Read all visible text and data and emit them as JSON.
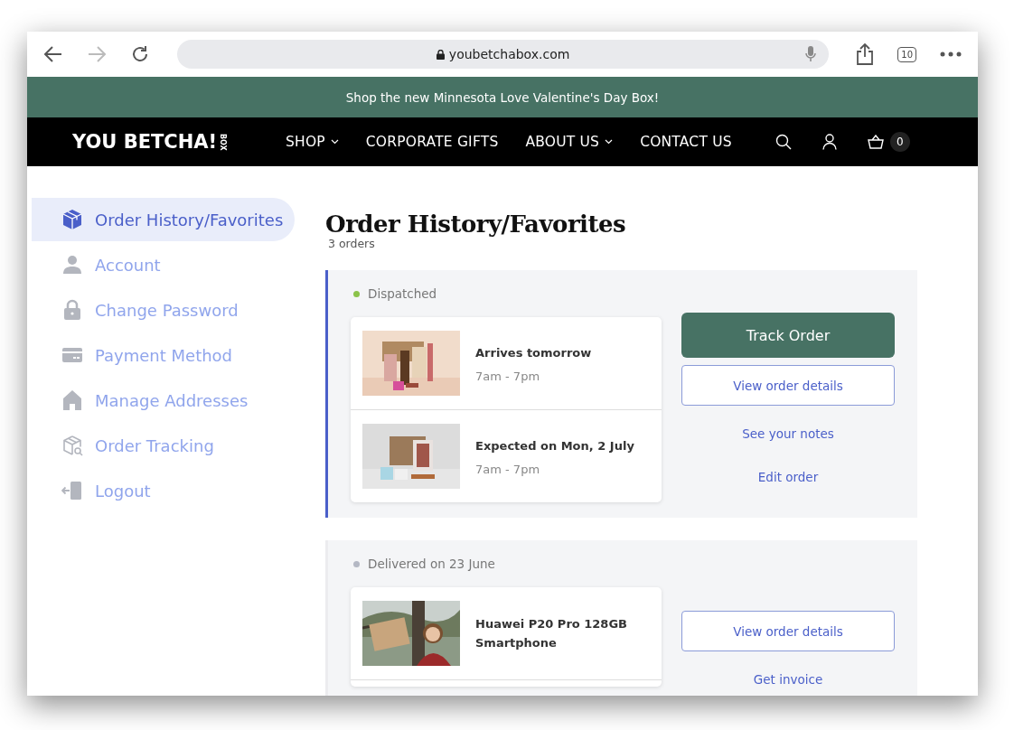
{
  "browser": {
    "url": "youbetchabox.com",
    "tab_count": "10"
  },
  "banner": {
    "text": "Shop the new Minnesota Love Valentine's Day Box!"
  },
  "header": {
    "logo": "YOU BETCHA!",
    "logo_sub": "BOX",
    "nav": [
      {
        "label": "SHOP",
        "dropdown": true
      },
      {
        "label": "CORPORATE GIFTS",
        "dropdown": false
      },
      {
        "label": "ABOUT US",
        "dropdown": true
      },
      {
        "label": "CONTACT US",
        "dropdown": false
      }
    ],
    "cart_count": "0"
  },
  "sidebar": {
    "items": [
      {
        "label": "Order History/Favorites",
        "selected": true
      },
      {
        "label": "Account",
        "selected": false
      },
      {
        "label": "Change Password",
        "selected": false
      },
      {
        "label": "Payment Method",
        "selected": false
      },
      {
        "label": "Manage Addresses",
        "selected": false
      },
      {
        "label": "Order Tracking",
        "selected": false
      },
      {
        "label": "Logout",
        "selected": false
      }
    ]
  },
  "page": {
    "title": "Order History/Favorites",
    "count": "3 orders"
  },
  "orders": [
    {
      "status": "Dispatched",
      "color": "#8bc34a",
      "selected": true,
      "items": [
        {
          "title": "Arrives tomorrow",
          "subtitle": "7am - 7pm",
          "kind": "picture"
        },
        {
          "title": "Expected on Mon, 2 July",
          "subtitle": "7am - 7pm",
          "kind": "picture"
        }
      ],
      "actions": [
        {
          "kind": "primary",
          "label": "Track Order"
        },
        {
          "kind": "outline",
          "label": "View order details"
        },
        {
          "kind": "link",
          "label": "See your notes"
        },
        {
          "kind": "link",
          "label": "Edit order"
        }
      ]
    },
    {
      "status": "Delivered on 23 June",
      "color": "#b4b8c4",
      "selected": false,
      "items": [
        {
          "title": "Huawei P20 Pro 128GB Smartphone",
          "kind": "picture"
        }
      ],
      "actions": [
        {
          "kind": "outline",
          "label": "View order details"
        },
        {
          "kind": "link",
          "label": "Get invoice"
        }
      ]
    }
  ]
}
